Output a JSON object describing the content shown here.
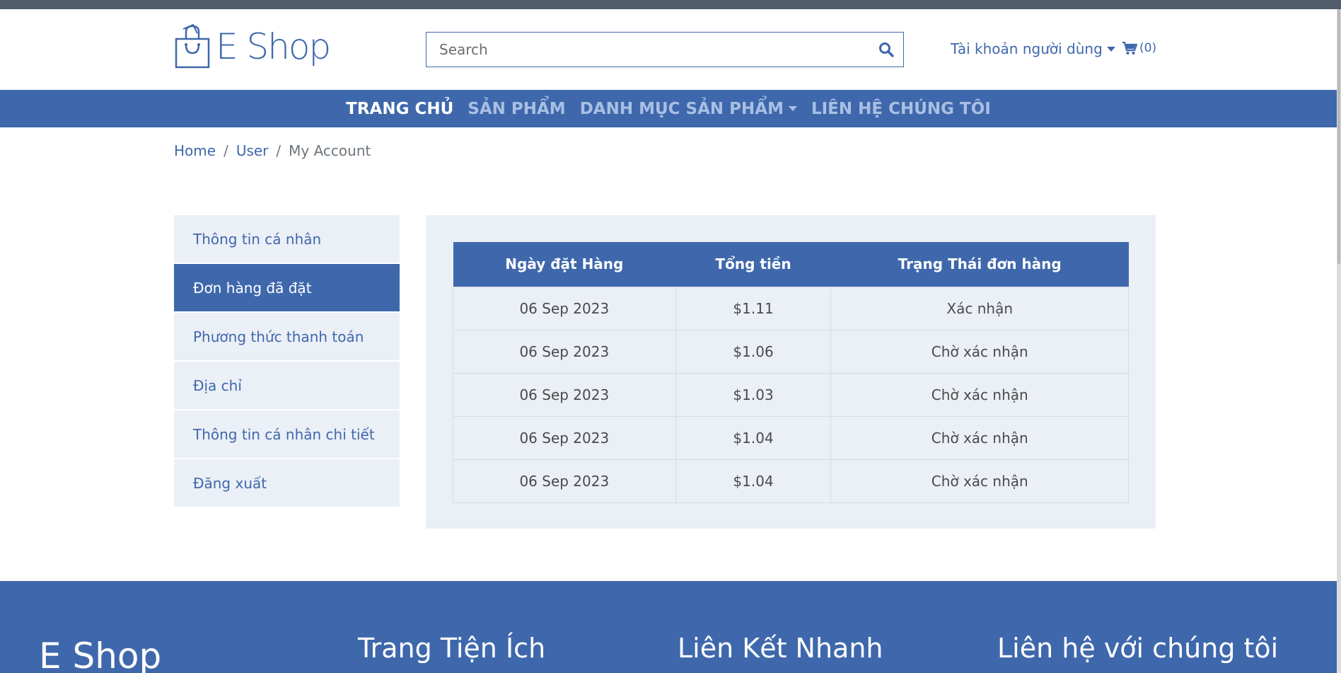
{
  "header": {
    "logo_text": "E Shop",
    "search_placeholder": "Search",
    "account_label": "Tài khoản người dùng",
    "cart_count": "(0)"
  },
  "nav": {
    "items": [
      {
        "label": "TRANG CHỦ",
        "active": true
      },
      {
        "label": "SẢN PHẨM",
        "active": false
      },
      {
        "label": "DANH MỤC SẢN PHẨM",
        "active": false,
        "dropdown": true
      },
      {
        "label": "LIÊN HỆ CHÚNG TÔI",
        "active": false
      }
    ]
  },
  "breadcrumb": {
    "home": "Home",
    "user": "User",
    "current": "My Account"
  },
  "sidebar": {
    "items": [
      {
        "label": "Thông tin cá nhân"
      },
      {
        "label": "Đơn hàng đã đặt",
        "active": true
      },
      {
        "label": "Phương thức thanh toán"
      },
      {
        "label": "Địa chỉ"
      },
      {
        "label": "Thông tin cá nhân chi tiết"
      },
      {
        "label": "Đăng xuất"
      }
    ]
  },
  "orders": {
    "headers": [
      "Ngày đặt Hàng",
      "Tổng tiền",
      "Trạng Thái đơn hàng"
    ],
    "rows": [
      [
        "06 Sep 2023",
        "$1.11",
        "Xác nhận"
      ],
      [
        "06 Sep 2023",
        "$1.06",
        "Chờ xác nhận"
      ],
      [
        "06 Sep 2023",
        "$1.03",
        "Chờ xác nhận"
      ],
      [
        "06 Sep 2023",
        "$1.04",
        "Chờ xác nhận"
      ],
      [
        "06 Sep 2023",
        "$1.04",
        "Chờ xác nhận"
      ]
    ]
  },
  "footer": {
    "brand": "E Shop",
    "col1": "Trang Tiện Ích",
    "col2": "Liên Kết Nhanh",
    "col3": "Liên hệ với chúng tôi"
  },
  "colors": {
    "primary": "#3f68ac",
    "panel_bg": "#ebeff6",
    "nav_inactive": "#a9bfe3"
  },
  "icons": {
    "logo": "shopping-bag-icon",
    "search": "search-icon",
    "cart": "cart-icon",
    "dropdown": "caret-down-icon"
  }
}
